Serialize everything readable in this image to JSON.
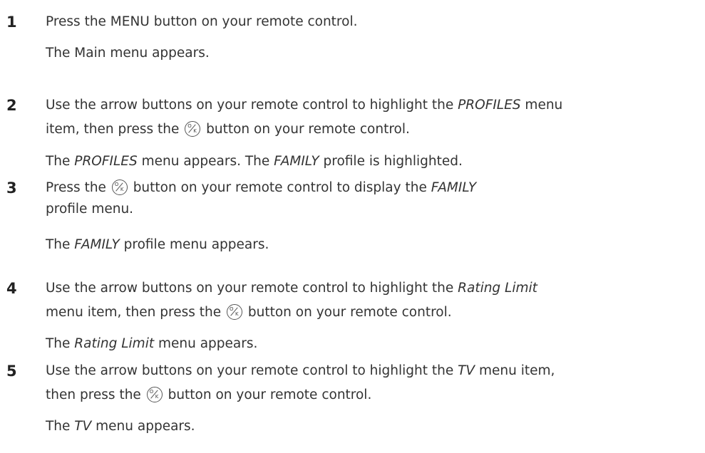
{
  "steps": [
    {
      "number": "1",
      "instruction": [
        {
          "type": "text",
          "value": "Press the MENU button on your remote control."
        }
      ],
      "result": [
        {
          "type": "text",
          "value": "The Main menu appears."
        }
      ]
    },
    {
      "number": "2",
      "instruction_line1": [
        {
          "type": "text",
          "value": "Use the arrow buttons on your remote control to highlight the "
        },
        {
          "type": "italic",
          "value": "PROFILES"
        },
        {
          "type": "text",
          "value": " menu"
        }
      ],
      "instruction_line2": [
        {
          "type": "text",
          "value": "item, then press the "
        },
        {
          "type": "icon",
          "value": "ok-button-icon",
          "letters": "OK"
        },
        {
          "type": "text",
          "value": " button on your remote control."
        }
      ],
      "result": [
        {
          "type": "text",
          "value": "The "
        },
        {
          "type": "italic",
          "value": "PROFILES"
        },
        {
          "type": "text",
          "value": " menu appears. The "
        },
        {
          "type": "italic",
          "value": "FAMILY"
        },
        {
          "type": "text",
          "value": " profile is highlighted."
        }
      ]
    },
    {
      "number": "3",
      "instruction_line1": [
        {
          "type": "text",
          "value": "Press the "
        },
        {
          "type": "icon",
          "value": "ok-button-icon",
          "letters": "OK"
        },
        {
          "type": "text",
          "value": " button on your remote control to display the "
        },
        {
          "type": "italic",
          "value": "FAMILY"
        }
      ],
      "instruction_line2": [
        {
          "type": "text",
          "value": "profile menu."
        }
      ],
      "result": [
        {
          "type": "text",
          "value": "The "
        },
        {
          "type": "italic",
          "value": "FAMILY"
        },
        {
          "type": "text",
          "value": " profile menu appears."
        }
      ]
    },
    {
      "number": "4",
      "instruction_line1": [
        {
          "type": "text",
          "value": "Use the arrow buttons on your remote control to highlight the "
        },
        {
          "type": "italic",
          "value": "Rating Limit"
        }
      ],
      "instruction_line2": [
        {
          "type": "text",
          "value": "menu item, then press the "
        },
        {
          "type": "icon",
          "value": "ok-button-icon",
          "letters": "OK"
        },
        {
          "type": "text",
          "value": " button on your remote control."
        }
      ],
      "result": [
        {
          "type": "text",
          "value": "The "
        },
        {
          "type": "italic",
          "value": "Rating Limit"
        },
        {
          "type": "text",
          "value": " menu appears."
        }
      ]
    },
    {
      "number": "5",
      "instruction_line1": [
        {
          "type": "text",
          "value": "Use the arrow buttons on your remote control to highlight the "
        },
        {
          "type": "italic",
          "value": "TV"
        },
        {
          "type": "text",
          "value": " menu item,"
        }
      ],
      "instruction_line2": [
        {
          "type": "text",
          "value": "then press the "
        },
        {
          "type": "icon",
          "value": "ok-button-icon",
          "letters": "OK"
        },
        {
          "type": "text",
          "value": " button on your remote control."
        }
      ],
      "result": [
        {
          "type": "text",
          "value": "The "
        },
        {
          "type": "italic",
          "value": "TV"
        },
        {
          "type": "text",
          "value": " menu appears."
        }
      ]
    }
  ]
}
